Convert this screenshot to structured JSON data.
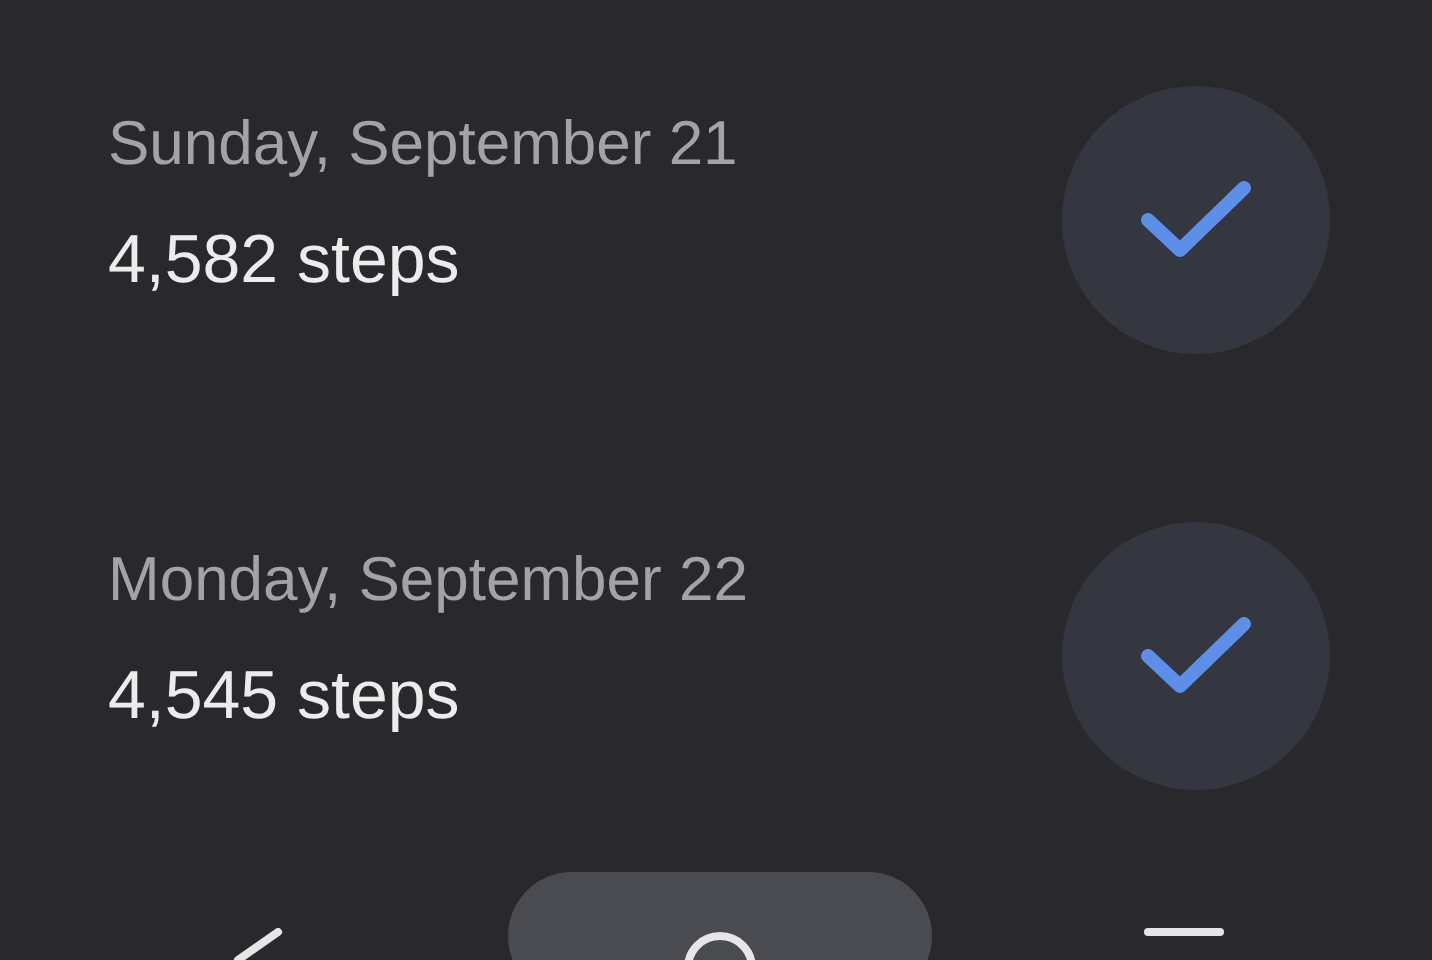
{
  "days": [
    {
      "date": "Sunday, September 21",
      "steps": "4,582 steps",
      "done": true
    },
    {
      "date": "Monday, September 22",
      "steps": "4,545 steps",
      "done": true
    }
  ],
  "nav_items": [
    {
      "selected": false
    },
    {
      "selected": true
    },
    {
      "selected": false
    }
  ]
}
